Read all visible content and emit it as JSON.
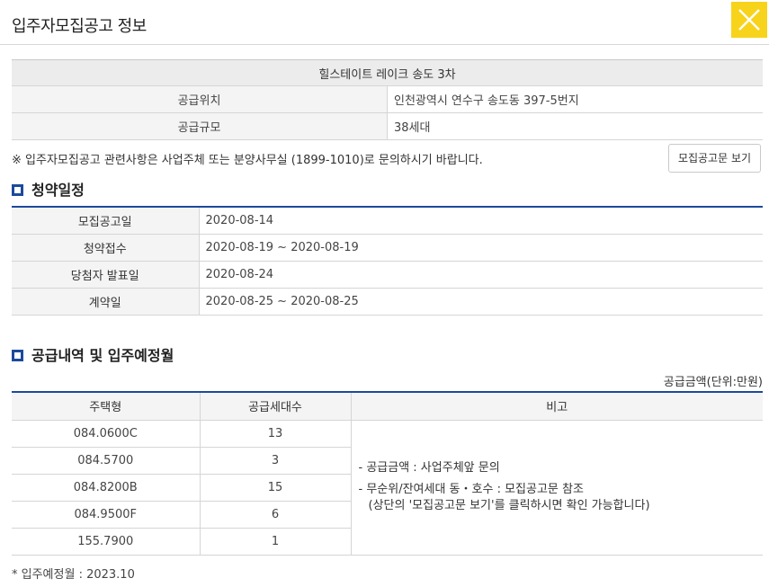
{
  "header": {
    "title": "입주자모집공고 정보"
  },
  "info": {
    "complex_name": "힐스테이트 레이크 송도 3차",
    "rows": [
      {
        "label": "공급위치",
        "value": "인천광역시 연수구 송도동 397-5번지"
      },
      {
        "label": "공급규모",
        "value": "38세대"
      }
    ]
  },
  "notice": {
    "text": "※ 입주자모집공고 관련사항은 사업주체 또는 분양사무실 (1899-1010)로 문의하시기 바랍니다.",
    "button_label": "모집공고문 보기"
  },
  "schedule": {
    "title": "청약일정",
    "rows": [
      {
        "label": "모집공고일",
        "value": "2020-08-14"
      },
      {
        "label": "청약접수",
        "value": "2020-08-19 ~ 2020-08-19"
      },
      {
        "label": "당첨자 발표일",
        "value": "2020-08-24"
      },
      {
        "label": "계약일",
        "value": "2020-08-25 ~ 2020-08-25"
      }
    ]
  },
  "supply": {
    "title": "공급내역 및 입주예정월",
    "unit": "공급금액(단위:만원)",
    "headers": [
      "주택형",
      "공급세대수",
      "비고"
    ],
    "rows": [
      {
        "type": "084.0600C",
        "count": "13"
      },
      {
        "type": "084.5700",
        "count": "3"
      },
      {
        "type": "084.8200B",
        "count": "15"
      },
      {
        "type": "084.9500F",
        "count": "6"
      },
      {
        "type": "155.7900",
        "count": "1"
      }
    ],
    "remarks": {
      "line1": "-  공급금액 : 사업주체앞 문의",
      "line2": "-  무순위/잔여세대 동・호수 : 모집공고문 참조",
      "line3": "(상단의 '모집공고문 보기'를 클릭하시면 확인 가능합니다)"
    }
  },
  "footer": {
    "move_in": "* 입주예정월 : 2023.10"
  },
  "colors": {
    "accent": "#1c4a9c",
    "close_bg": "#f7d31b"
  },
  "icons": {
    "close": "close-icon",
    "section": "square-bullet-icon"
  }
}
